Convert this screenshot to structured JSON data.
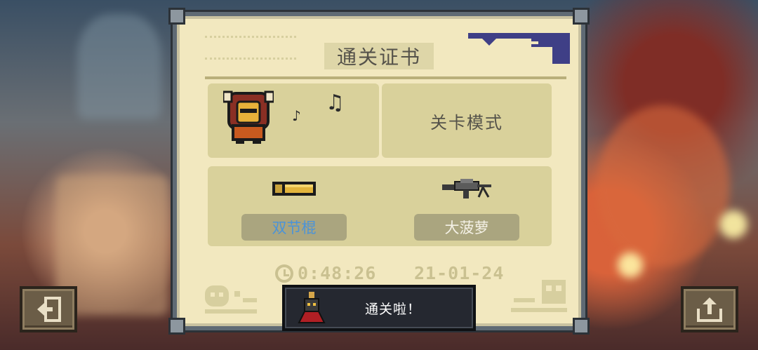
{
  "certificate": {
    "title": "通关证书",
    "mode": "关卡模式",
    "hero_icon": "horned-knight-icon",
    "weapons": [
      {
        "icon": "nunchaku-icon",
        "label": "双节棍",
        "label_color": "#4b93d8"
      },
      {
        "icon": "rifle-icon",
        "label": "大菠萝",
        "label_color": "#f4f1e6"
      }
    ],
    "time": "0:48:26",
    "date": "21-01-24"
  },
  "toast": {
    "icon": "boss-icon",
    "message": "通关啦！"
  },
  "buttons": {
    "exit_icon": "exit-icon",
    "share_icon": "share-icon"
  }
}
